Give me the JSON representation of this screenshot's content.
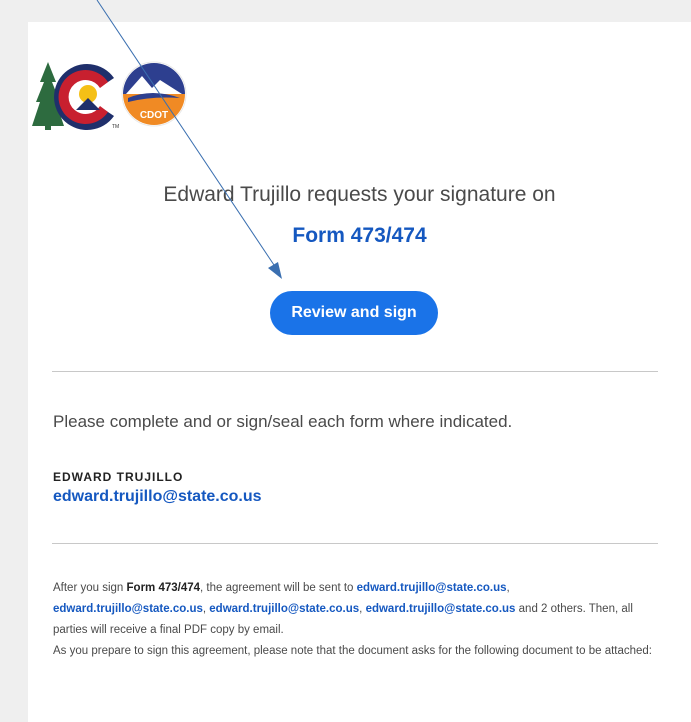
{
  "header": {
    "title": "Edward Trujillo requests your signature on",
    "form_name": "Form 473/474"
  },
  "logos": {
    "state_logo": "colorado-c-icon",
    "cdot_logo": "cdot-icon",
    "cdot_text": "CDOT",
    "tm_text": "TM"
  },
  "cta": {
    "label": "Review and sign"
  },
  "message": "Please complete and or sign/seal each form where indicated.",
  "sender": {
    "name": "EDWARD TRUJILLO",
    "email": "edward.trujillo@state.co.us"
  },
  "footer": {
    "p1_a": "After you sign ",
    "p1_form": "Form 473/474",
    "p1_b": ", the agreement will be sent to ",
    "emails": [
      "edward.trujillo@state.co.us",
      "edward.trujillo@state.co.us",
      "edward.trujillo@state.co.us",
      "edward.trujillo@state.co.us"
    ],
    "sep": ", ",
    "p1_c": " and 2 others. Then, all parties will receive a final PDF copy by email.",
    "p2": "As you prepare to sign this agreement, please note that the document asks for the following document to be attached:"
  },
  "colors": {
    "accent": "#1a73e8",
    "link": "#1558c0",
    "background": "#efefef"
  }
}
